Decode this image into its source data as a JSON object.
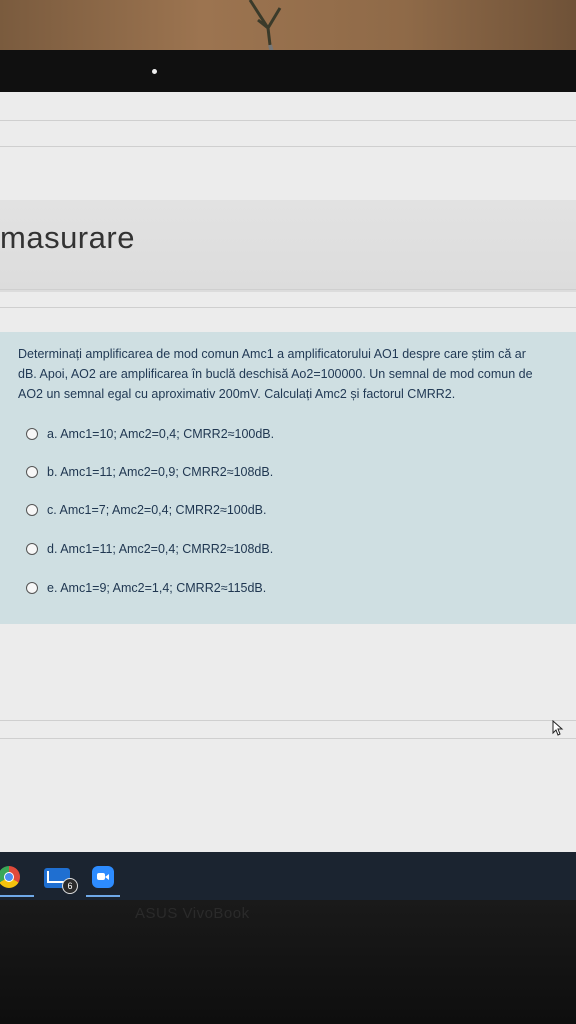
{
  "page": {
    "title": "masurare"
  },
  "question": {
    "lines": [
      "Determinați amplificarea de mod comun Amc1 a amplificatorului AO1 despre care știm că ar",
      "dB. Apoi, AO2 are amplificarea în buclă deschisă Ao2=100000.  Un semnal de mod comun de",
      "AO2 un semnal egal cu aproximativ 200mV. Calculați Amc2 și factorul CMRR2."
    ],
    "options": [
      {
        "label": "a. Amc1=10; Amc2=0,4; CMRR2≈100dB."
      },
      {
        "label": "b. Amc1=11; Amc2=0,9; CMRR2≈108dB."
      },
      {
        "label": "c. Amc1=7; Amc2=0,4; CMRR2≈100dB."
      },
      {
        "label": "d. Amc1=11; Amc2=0,4; CMRR2≈108dB."
      },
      {
        "label": "e. Amc1=9; Amc2=1,4; CMRR2≈115dB."
      }
    ]
  },
  "taskbar": {
    "mail_badge": "6",
    "icons": [
      "chrome-icon",
      "mail-icon",
      "zoom-icon"
    ]
  },
  "device": {
    "brand": "ASUS VivoBook"
  },
  "colors": {
    "question_bg": "#cfdfe2",
    "page_bg": "#ececec",
    "taskbar_bg": "#1b2430",
    "text": "#223a55"
  }
}
